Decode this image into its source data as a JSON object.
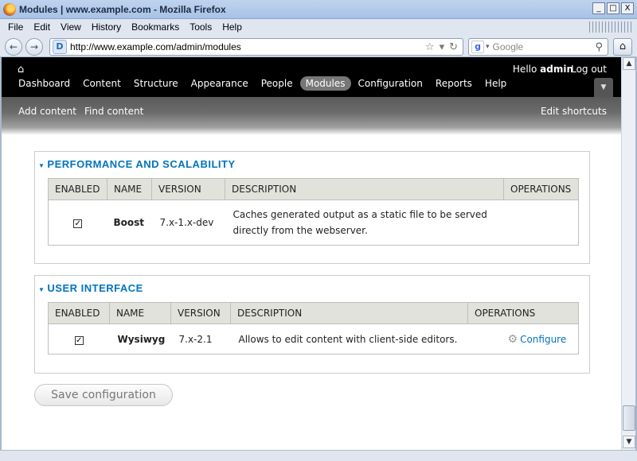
{
  "window": {
    "title": "Modules | www.example.com - Mozilla Firefox",
    "controls": {
      "minimize": "_",
      "maximize": "□",
      "close": "X"
    }
  },
  "menu": [
    "File",
    "Edit",
    "View",
    "History",
    "Bookmarks",
    "Tools",
    "Help"
  ],
  "nav": {
    "back_icon": "←",
    "forward_icon": "→",
    "url": "http://www.example.com/admin/modules",
    "search_placeholder": "Google",
    "star_icon": "☆",
    "reload_icon": "↻",
    "home_icon": "⌂"
  },
  "toolbar": {
    "home_icon": "⌂",
    "greeting": "Hello ",
    "username": "admin",
    "logout": "Log out",
    "items": [
      "Dashboard",
      "Content",
      "Structure",
      "Appearance",
      "People",
      "Modules",
      "Configuration",
      "Reports",
      "Help"
    ],
    "active": "Modules"
  },
  "shortcuts": {
    "add_content": "Add content",
    "find_content": "Find content",
    "edit_shortcuts": "Edit shortcuts"
  },
  "sections": [
    {
      "legend": "PERFORMANCE AND SCALABILITY",
      "headers": [
        "ENABLED",
        "NAME",
        "VERSION",
        "DESCRIPTION",
        "OPERATIONS"
      ],
      "rows": [
        {
          "enabled": true,
          "name": "Boost",
          "version": "7.x-1.x-dev",
          "description_line1": "Caches generated output as a static file to be served",
          "description_line2": "directly from the webserver.",
          "operation": ""
        }
      ]
    },
    {
      "legend": "USER INTERFACE",
      "headers": [
        "ENABLED",
        "NAME",
        "VERSION",
        "DESCRIPTION",
        "OPERATIONS"
      ],
      "rows": [
        {
          "enabled": true,
          "name": "Wysiwyg",
          "version": "7.x-2.1",
          "description_line1": "Allows to edit content with client-side editors.",
          "description_line2": "",
          "operation": "Configure"
        }
      ]
    }
  ],
  "save_button": "Save configuration",
  "icons": {
    "checkbox_checked": "✓",
    "gear": "⚙",
    "collapse": "▼"
  },
  "colors": {
    "link": "#0074bd",
    "toolbar_bg": "#000000",
    "active_tab": "#777777"
  }
}
